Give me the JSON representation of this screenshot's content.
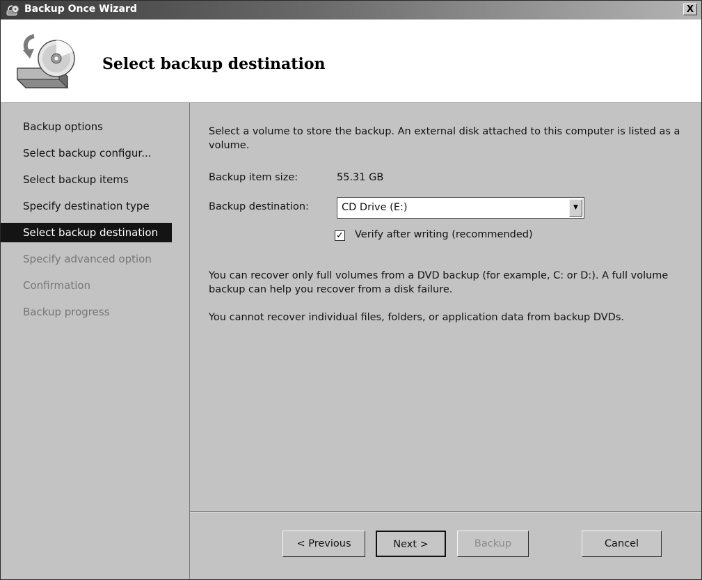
{
  "window": {
    "title": "Backup Once Wizard",
    "close_label": "X",
    "app_icon": "backup-wizard-icon"
  },
  "header": {
    "title": "Select backup destination",
    "icon": "backup-disk-icon"
  },
  "nav": {
    "items": [
      {
        "label": "Backup options",
        "state": "normal"
      },
      {
        "label": "Select backup configur...",
        "state": "normal"
      },
      {
        "label": "Select backup items",
        "state": "normal"
      },
      {
        "label": "Specify destination type",
        "state": "normal"
      },
      {
        "label": "Select backup destination",
        "state": "active"
      },
      {
        "label": "Specify advanced option",
        "state": "disabled"
      },
      {
        "label": "Confirmation",
        "state": "disabled"
      },
      {
        "label": "Backup progress",
        "state": "disabled"
      }
    ]
  },
  "main": {
    "intro": "Select a volume to store the backup. An external disk attached to this computer is listed as a volume.",
    "item_size_label": "Backup item size:",
    "item_size_value": "55.31 GB",
    "destination_label": "Backup destination:",
    "destination_value": "CD Drive (E:)",
    "verify_label": "Verify after writing (recommended)",
    "verify_checked": true,
    "note1": "You can recover only full volumes from a DVD backup (for example, C: or D:). A full volume backup can help you recover from a disk failure.",
    "note2": "You cannot recover individual files, folders, or application data from backup DVDs."
  },
  "buttons": {
    "previous": "< Previous",
    "next": "Next >",
    "backup": "Backup",
    "cancel": "Cancel"
  },
  "colors": {
    "window_bg": "#c3c3c3",
    "active_item_bg": "#141414",
    "disabled_text": "#767676"
  }
}
